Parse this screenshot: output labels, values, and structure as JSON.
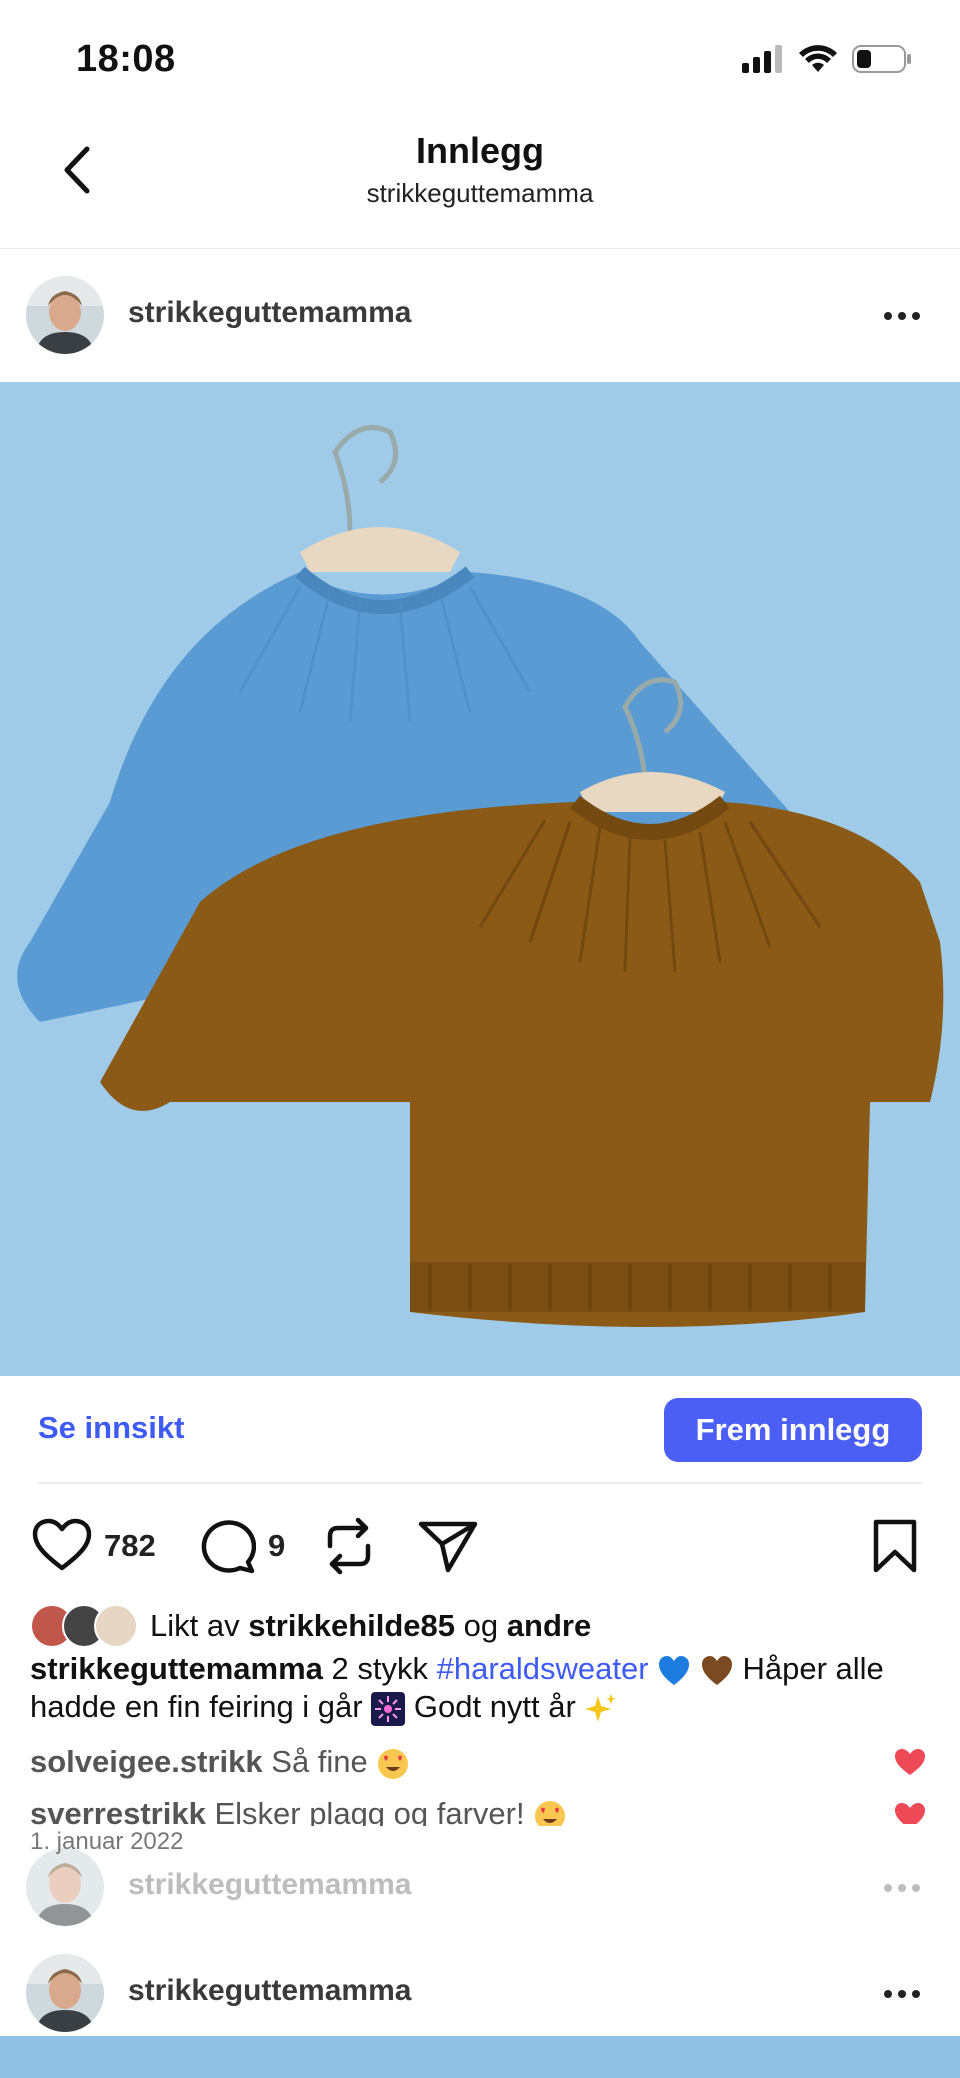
{
  "status_bar": {
    "time": "18:08"
  },
  "nav": {
    "title": "Innlegg",
    "subtitle": "strikkeguttemamma"
  },
  "post": {
    "username": "strikkeguttemamma",
    "photo_alt_icon": "sweater-photo",
    "insight_label": "Se innsikt",
    "promote_label": "Frem innlegg",
    "likes_count": "782",
    "comments_count": "9",
    "liked_by_prefix": "Likt av",
    "liked_by_user": "strikkehilde85",
    "liked_by_and": "og",
    "liked_by_others": "andre",
    "caption_user": "strikkeguttemamma",
    "caption_text1": "2 stykk",
    "caption_hashtag": "#haraldsweater",
    "caption_text2": "Håper alle hadde en fin feiring i går",
    "caption_text3": "Godt nytt år",
    "comments": [
      {
        "user": "solveigee.strikk",
        "text": "Så fine"
      },
      {
        "user": "sverrestrikk",
        "text": "Elsker plagg og farver!"
      }
    ],
    "date": "1. januar 2022"
  },
  "next_posts": [
    {
      "username": "strikkeguttemamma"
    },
    {
      "username": "strikkeguttemamma"
    }
  ],
  "colors": {
    "accent": "#4c5ff5",
    "link": "#3f5bf5",
    "photo_bg": "#9fcbe9",
    "heart_red": "#ed4956"
  }
}
